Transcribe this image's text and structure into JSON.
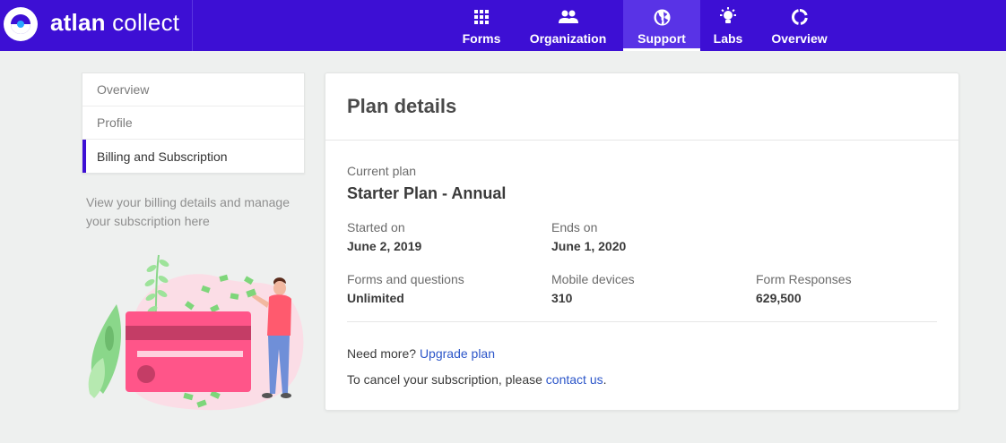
{
  "brand": {
    "bold": "atlan",
    "light": " collect"
  },
  "nav": [
    {
      "label": "Forms",
      "icon": "grid-icon",
      "active": false
    },
    {
      "label": "Organization",
      "icon": "people-icon",
      "active": false
    },
    {
      "label": "Support",
      "icon": "globe-icon",
      "active": true
    },
    {
      "label": "Labs",
      "icon": "lightbulb-icon",
      "active": false
    },
    {
      "label": "Overview",
      "icon": "donut-chart-icon",
      "active": false
    }
  ],
  "sidebar": {
    "items": [
      {
        "label": "Overview",
        "active": false
      },
      {
        "label": "Profile",
        "active": false
      },
      {
        "label": "Billing and Subscription",
        "active": true
      }
    ],
    "description": "View your billing details and manage your subscription here"
  },
  "plan": {
    "title": "Plan details",
    "current_plan_label": "Current plan",
    "current_plan_value": "Starter Plan - Annual",
    "started_label": "Started on",
    "started_value": "June 2, 2019",
    "ends_label": "Ends on",
    "ends_value": "June 1, 2020",
    "forms_label": "Forms and questions",
    "forms_value": "Unlimited",
    "devices_label": "Mobile devices",
    "devices_value": "310",
    "responses_label": "Form Responses",
    "responses_value": "629,500",
    "need_more_text": "Need more?",
    "upgrade_link": "Upgrade plan",
    "cancel_text": "To cancel your subscription, please",
    "contact_link": "contact us",
    "cancel_end": "."
  },
  "colors": {
    "primary": "#3d0fd4",
    "active_tab": "#5933e6",
    "link": "#2c56c9",
    "card_pink": "#ff5589"
  }
}
